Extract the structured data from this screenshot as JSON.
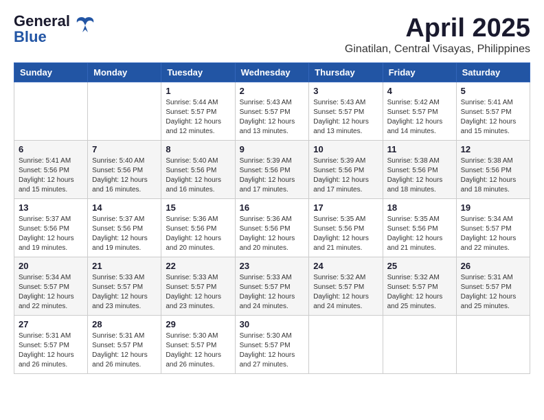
{
  "header": {
    "logo_general": "General",
    "logo_blue": "Blue",
    "month_title": "April 2025",
    "location": "Ginatilan, Central Visayas, Philippines"
  },
  "weekdays": [
    "Sunday",
    "Monday",
    "Tuesday",
    "Wednesday",
    "Thursday",
    "Friday",
    "Saturday"
  ],
  "weeks": [
    [
      {
        "day": "",
        "sunrise": "",
        "sunset": "",
        "daylight": ""
      },
      {
        "day": "",
        "sunrise": "",
        "sunset": "",
        "daylight": ""
      },
      {
        "day": "1",
        "sunrise": "Sunrise: 5:44 AM",
        "sunset": "Sunset: 5:57 PM",
        "daylight": "Daylight: 12 hours and 12 minutes."
      },
      {
        "day": "2",
        "sunrise": "Sunrise: 5:43 AM",
        "sunset": "Sunset: 5:57 PM",
        "daylight": "Daylight: 12 hours and 13 minutes."
      },
      {
        "day": "3",
        "sunrise": "Sunrise: 5:43 AM",
        "sunset": "Sunset: 5:57 PM",
        "daylight": "Daylight: 12 hours and 13 minutes."
      },
      {
        "day": "4",
        "sunrise": "Sunrise: 5:42 AM",
        "sunset": "Sunset: 5:57 PM",
        "daylight": "Daylight: 12 hours and 14 minutes."
      },
      {
        "day": "5",
        "sunrise": "Sunrise: 5:41 AM",
        "sunset": "Sunset: 5:57 PM",
        "daylight": "Daylight: 12 hours and 15 minutes."
      }
    ],
    [
      {
        "day": "6",
        "sunrise": "Sunrise: 5:41 AM",
        "sunset": "Sunset: 5:56 PM",
        "daylight": "Daylight: 12 hours and 15 minutes."
      },
      {
        "day": "7",
        "sunrise": "Sunrise: 5:40 AM",
        "sunset": "Sunset: 5:56 PM",
        "daylight": "Daylight: 12 hours and 16 minutes."
      },
      {
        "day": "8",
        "sunrise": "Sunrise: 5:40 AM",
        "sunset": "Sunset: 5:56 PM",
        "daylight": "Daylight: 12 hours and 16 minutes."
      },
      {
        "day": "9",
        "sunrise": "Sunrise: 5:39 AM",
        "sunset": "Sunset: 5:56 PM",
        "daylight": "Daylight: 12 hours and 17 minutes."
      },
      {
        "day": "10",
        "sunrise": "Sunrise: 5:39 AM",
        "sunset": "Sunset: 5:56 PM",
        "daylight": "Daylight: 12 hours and 17 minutes."
      },
      {
        "day": "11",
        "sunrise": "Sunrise: 5:38 AM",
        "sunset": "Sunset: 5:56 PM",
        "daylight": "Daylight: 12 hours and 18 minutes."
      },
      {
        "day": "12",
        "sunrise": "Sunrise: 5:38 AM",
        "sunset": "Sunset: 5:56 PM",
        "daylight": "Daylight: 12 hours and 18 minutes."
      }
    ],
    [
      {
        "day": "13",
        "sunrise": "Sunrise: 5:37 AM",
        "sunset": "Sunset: 5:56 PM",
        "daylight": "Daylight: 12 hours and 19 minutes."
      },
      {
        "day": "14",
        "sunrise": "Sunrise: 5:37 AM",
        "sunset": "Sunset: 5:56 PM",
        "daylight": "Daylight: 12 hours and 19 minutes."
      },
      {
        "day": "15",
        "sunrise": "Sunrise: 5:36 AM",
        "sunset": "Sunset: 5:56 PM",
        "daylight": "Daylight: 12 hours and 20 minutes."
      },
      {
        "day": "16",
        "sunrise": "Sunrise: 5:36 AM",
        "sunset": "Sunset: 5:56 PM",
        "daylight": "Daylight: 12 hours and 20 minutes."
      },
      {
        "day": "17",
        "sunrise": "Sunrise: 5:35 AM",
        "sunset": "Sunset: 5:56 PM",
        "daylight": "Daylight: 12 hours and 21 minutes."
      },
      {
        "day": "18",
        "sunrise": "Sunrise: 5:35 AM",
        "sunset": "Sunset: 5:56 PM",
        "daylight": "Daylight: 12 hours and 21 minutes."
      },
      {
        "day": "19",
        "sunrise": "Sunrise: 5:34 AM",
        "sunset": "Sunset: 5:57 PM",
        "daylight": "Daylight: 12 hours and 22 minutes."
      }
    ],
    [
      {
        "day": "20",
        "sunrise": "Sunrise: 5:34 AM",
        "sunset": "Sunset: 5:57 PM",
        "daylight": "Daylight: 12 hours and 22 minutes."
      },
      {
        "day": "21",
        "sunrise": "Sunrise: 5:33 AM",
        "sunset": "Sunset: 5:57 PM",
        "daylight": "Daylight: 12 hours and 23 minutes."
      },
      {
        "day": "22",
        "sunrise": "Sunrise: 5:33 AM",
        "sunset": "Sunset: 5:57 PM",
        "daylight": "Daylight: 12 hours and 23 minutes."
      },
      {
        "day": "23",
        "sunrise": "Sunrise: 5:33 AM",
        "sunset": "Sunset: 5:57 PM",
        "daylight": "Daylight: 12 hours and 24 minutes."
      },
      {
        "day": "24",
        "sunrise": "Sunrise: 5:32 AM",
        "sunset": "Sunset: 5:57 PM",
        "daylight": "Daylight: 12 hours and 24 minutes."
      },
      {
        "day": "25",
        "sunrise": "Sunrise: 5:32 AM",
        "sunset": "Sunset: 5:57 PM",
        "daylight": "Daylight: 12 hours and 25 minutes."
      },
      {
        "day": "26",
        "sunrise": "Sunrise: 5:31 AM",
        "sunset": "Sunset: 5:57 PM",
        "daylight": "Daylight: 12 hours and 25 minutes."
      }
    ],
    [
      {
        "day": "27",
        "sunrise": "Sunrise: 5:31 AM",
        "sunset": "Sunset: 5:57 PM",
        "daylight": "Daylight: 12 hours and 26 minutes."
      },
      {
        "day": "28",
        "sunrise": "Sunrise: 5:31 AM",
        "sunset": "Sunset: 5:57 PM",
        "daylight": "Daylight: 12 hours and 26 minutes."
      },
      {
        "day": "29",
        "sunrise": "Sunrise: 5:30 AM",
        "sunset": "Sunset: 5:57 PM",
        "daylight": "Daylight: 12 hours and 26 minutes."
      },
      {
        "day": "30",
        "sunrise": "Sunrise: 5:30 AM",
        "sunset": "Sunset: 5:57 PM",
        "daylight": "Daylight: 12 hours and 27 minutes."
      },
      {
        "day": "",
        "sunrise": "",
        "sunset": "",
        "daylight": ""
      },
      {
        "day": "",
        "sunrise": "",
        "sunset": "",
        "daylight": ""
      },
      {
        "day": "",
        "sunrise": "",
        "sunset": "",
        "daylight": ""
      }
    ]
  ]
}
